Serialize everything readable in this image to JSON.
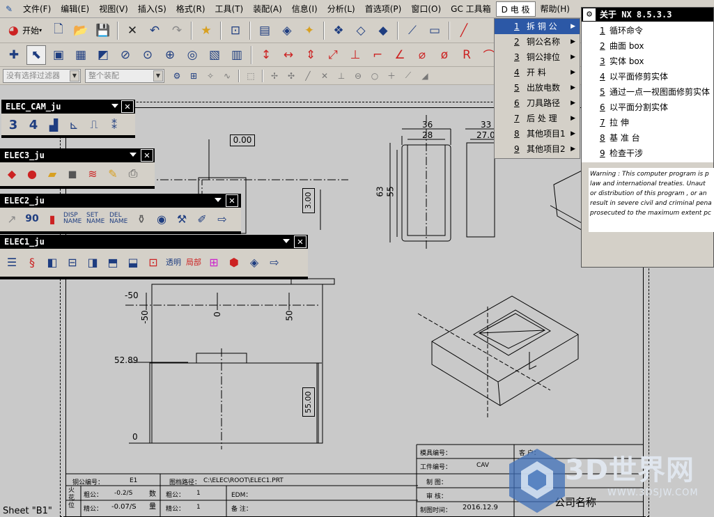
{
  "menubar": {
    "items": [
      "文件(F)",
      "编辑(E)",
      "视图(V)",
      "插入(S)",
      "格式(R)",
      "工具(T)",
      "装配(A)",
      "信息(I)",
      "分析(L)",
      "首选项(P)",
      "窗口(O)",
      "GC 工具箱",
      "D 电 极",
      "帮助(H)"
    ]
  },
  "toolbar": {
    "start_label": "开始",
    "filter_placeholder": "没有选择过滤器",
    "assembly_placeholder": "整个装配"
  },
  "palettes": {
    "cam": {
      "title": "ELEC_CAM_ju",
      "icons": [
        "3",
        "4"
      ]
    },
    "elec3": {
      "title": "ELEC3_ju"
    },
    "elec2": {
      "title": "ELEC2_ju",
      "icons": [
        "90",
        "DISP NAME",
        "SET NAME",
        "DEL NAME"
      ]
    },
    "elec1": {
      "title": "ELEC1_ju",
      "icons": [
        "透明",
        "局部"
      ]
    }
  },
  "electrode_menu": {
    "items": [
      {
        "num": "1",
        "label": "拆 铜 公"
      },
      {
        "num": "2",
        "label": "铜公名称"
      },
      {
        "num": "3",
        "label": "铜公排位"
      },
      {
        "num": "4",
        "label": "开   料"
      },
      {
        "num": "5",
        "label": "出放电数"
      },
      {
        "num": "6",
        "label": "刀具路径"
      },
      {
        "num": "7",
        "label": "后 处 理"
      },
      {
        "num": "8",
        "label": "其他项目1"
      },
      {
        "num": "9",
        "label": "其他项目2"
      }
    ]
  },
  "about_panel": {
    "title": "关于 NX 8.5.3.3",
    "items": [
      {
        "num": "1",
        "label": "循环命令"
      },
      {
        "num": "2",
        "label": "曲面 box"
      },
      {
        "num": "3",
        "label": "实体 box"
      },
      {
        "num": "4",
        "label": "以平面修剪实体"
      },
      {
        "num": "5",
        "label": "通过一点一视图面修剪实体"
      },
      {
        "num": "6",
        "label": "以平面分割实体"
      },
      {
        "num": "7",
        "label": "拉  伸"
      },
      {
        "num": "8",
        "label": "基 准 台"
      },
      {
        "num": "9",
        "label": "检查干涉"
      }
    ],
    "warning": [
      "Warning : This computer program is p",
      "law and international treaties. Unaut",
      "or distribution of this program , or an",
      "result in severe civil and criminal pena",
      "prosecuted to the maximum extent pc"
    ]
  },
  "drawing": {
    "dims": [
      "0.00",
      "3.00",
      "36",
      "28",
      "33",
      "27.0",
      "63",
      "55",
      "-50",
      "-50",
      "0",
      "50",
      "52.89",
      "0",
      "55.00"
    ],
    "title_block": {
      "mold_no_label": "模具编号：",
      "work_no_label": "工件编号：",
      "work_no_value": "CAV",
      "customer_label": "客 户：",
      "drawer_label": "制  图：",
      "review_label": "审  核：",
      "time_label": "制图时间：",
      "time_value": "2016.12.9",
      "company": "公司名称",
      "elec_no_label": "铜公编号：",
      "elec_no_value": "E1",
      "path_label": "图档路径：",
      "path_value": "C:\\ELEC\\ROOT\\ELEC1.PRT",
      "spark_label": "火花位",
      "rough_label": "粗公：",
      "rough_value": "-0.2/S",
      "fine_label": "精公：",
      "fine_value": "-0.07/S",
      "qty_label": "数量",
      "rough_qty_label": "粗公：",
      "rough_qty": "1",
      "fine_qty_label": "精公：",
      "fine_qty": "1",
      "edm_label": "EDM：",
      "remark_label": "备  注："
    }
  },
  "status": {
    "sheet": "Sheet \"B1\""
  },
  "watermark": {
    "brand": "3D世界网",
    "url": "WWW.3DSJW.COM"
  }
}
